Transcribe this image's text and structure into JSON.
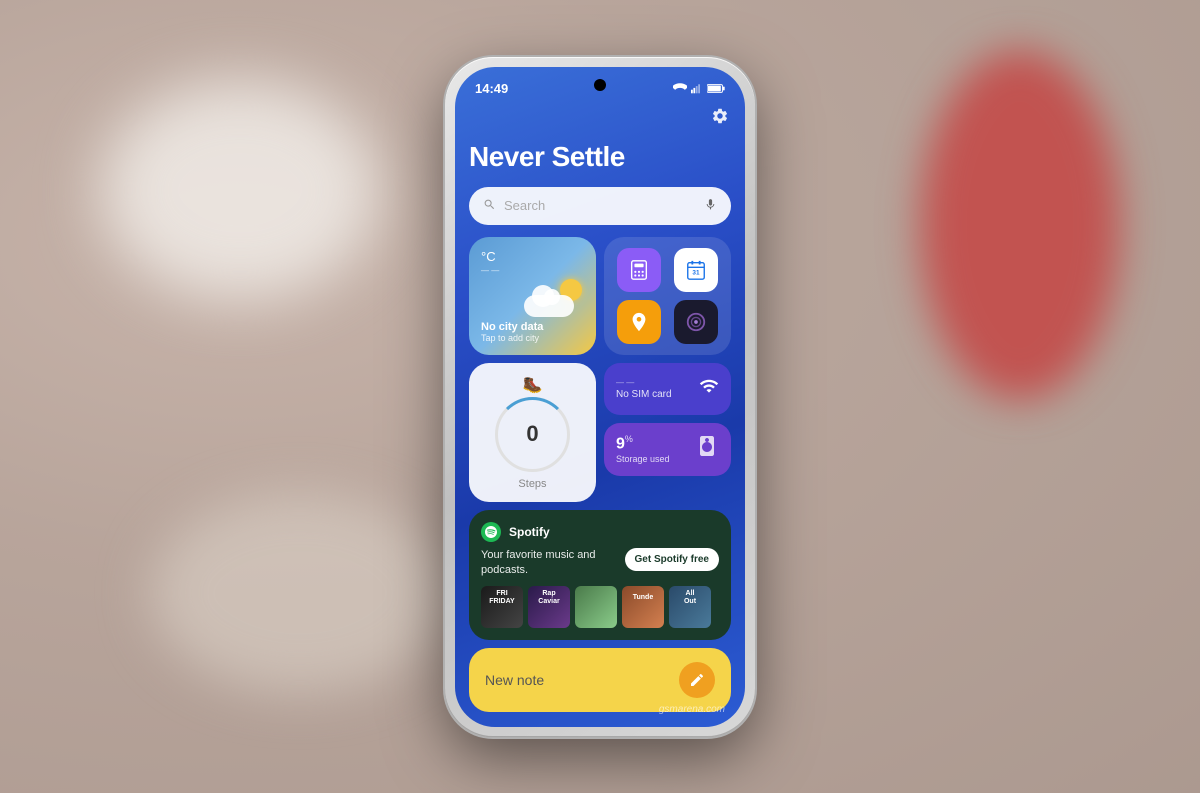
{
  "background": {
    "color": "#c8b0a8"
  },
  "phone": {
    "status_bar": {
      "time": "14:49",
      "settings_icon": "⚙",
      "wifi_icon": "wifi",
      "signal_icon": "signal",
      "battery_icon": "battery"
    },
    "screen": {
      "tagline": "Never Settle",
      "search": {
        "placeholder": "Search",
        "mic_label": "mic"
      },
      "weather_widget": {
        "temp_unit": "°C",
        "city_label": "No city data",
        "tap_label": "Tap to add city"
      },
      "app_grid": {
        "apps": [
          {
            "name": "Calculator",
            "color": "#8b5cf6"
          },
          {
            "name": "Calendar",
            "color": "#ffffff"
          },
          {
            "name": "Maps",
            "color": "#f59e0b"
          },
          {
            "name": "Camera",
            "color": "#1a1a2e"
          }
        ]
      },
      "steps_widget": {
        "count": "0",
        "label": "Steps"
      },
      "sim_widget": {
        "text": "No SIM card",
        "icon": "signal"
      },
      "storage_widget": {
        "percent": "9",
        "percent_symbol": "%",
        "label": "Storage used",
        "icon": "bookmark"
      },
      "spotify_widget": {
        "app_name": "Spotify",
        "description": "Your favorite music and podcasts.",
        "cta_button": "Get Spotify free",
        "albums": [
          {
            "label": "FRI FRIDAY",
            "style": "album-1"
          },
          {
            "label": "RapCaviar",
            "style": "album-2"
          },
          {
            "label": "",
            "style": "album-3"
          },
          {
            "label": "Tunde...",
            "style": "album-4"
          },
          {
            "label": "All Out",
            "style": "album-5"
          }
        ]
      },
      "note_widget": {
        "label": "New note",
        "edit_icon": "✏"
      }
    }
  },
  "watermark": "gsmarena.com"
}
